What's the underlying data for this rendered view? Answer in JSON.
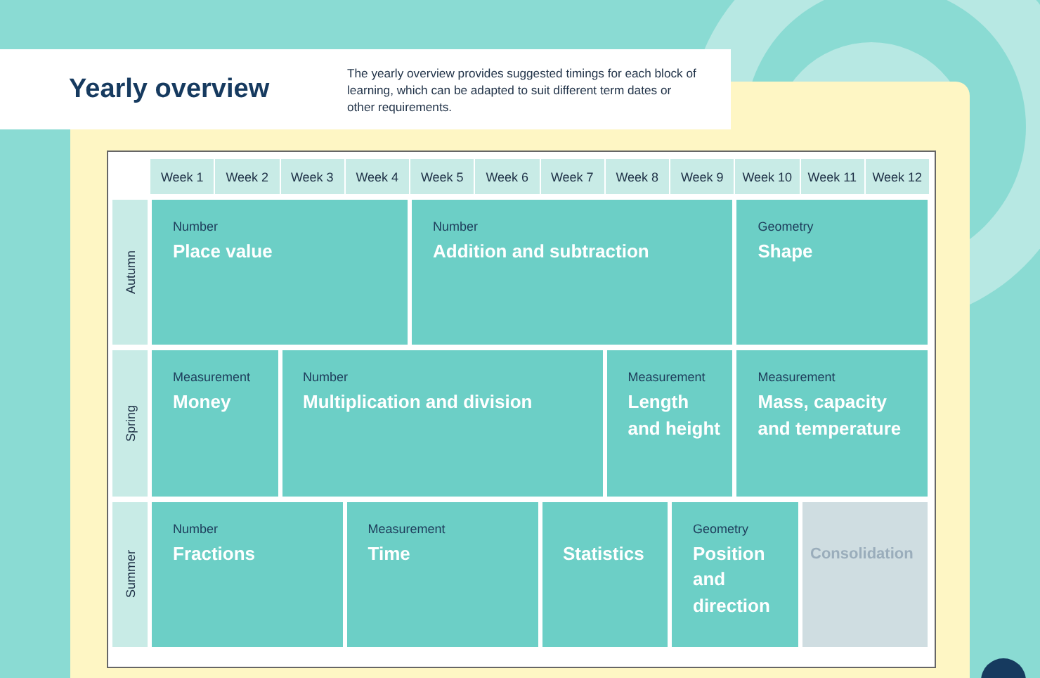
{
  "header": {
    "title": "Yearly overview",
    "description": "The yearly overview provides suggested timings for each block of learning, which can be adapted to suit different term dates or other requirements."
  },
  "weeks": [
    "Week 1",
    "Week 2",
    "Week 3",
    "Week 4",
    "Week 5",
    "Week 6",
    "Week 7",
    "Week 8",
    "Week 9",
    "Week 10",
    "Week 11",
    "Week 12"
  ],
  "terms": [
    {
      "name": "Autumn",
      "blocks": [
        {
          "kind": "topic",
          "category": "Number",
          "title": "Place value"
        },
        {
          "kind": "topic",
          "category": "Number",
          "title": "Addition and subtraction"
        },
        {
          "kind": "topic",
          "category": "Geometry",
          "title": "Shape"
        }
      ]
    },
    {
      "name": "Spring",
      "blocks": [
        {
          "kind": "topic",
          "category": "Measurement",
          "title": "Money"
        },
        {
          "kind": "topic",
          "category": "Number",
          "title": "Multiplication and division"
        },
        {
          "kind": "topic",
          "category": "Measurement",
          "title": "Length and height"
        },
        {
          "kind": "topic",
          "category": "Measurement",
          "title": "Mass, capacity and temperature"
        }
      ]
    },
    {
      "name": "Summer",
      "blocks": [
        {
          "kind": "topic",
          "category": "Number",
          "title": "Fractions"
        },
        {
          "kind": "topic",
          "category": "Measurement",
          "title": "Time"
        },
        {
          "kind": "topic",
          "title": "Statistics"
        },
        {
          "kind": "topic",
          "category": "Geometry",
          "title": "Position and direction"
        },
        {
          "kind": "consolidation",
          "title": "Consolidation"
        }
      ]
    }
  ]
}
